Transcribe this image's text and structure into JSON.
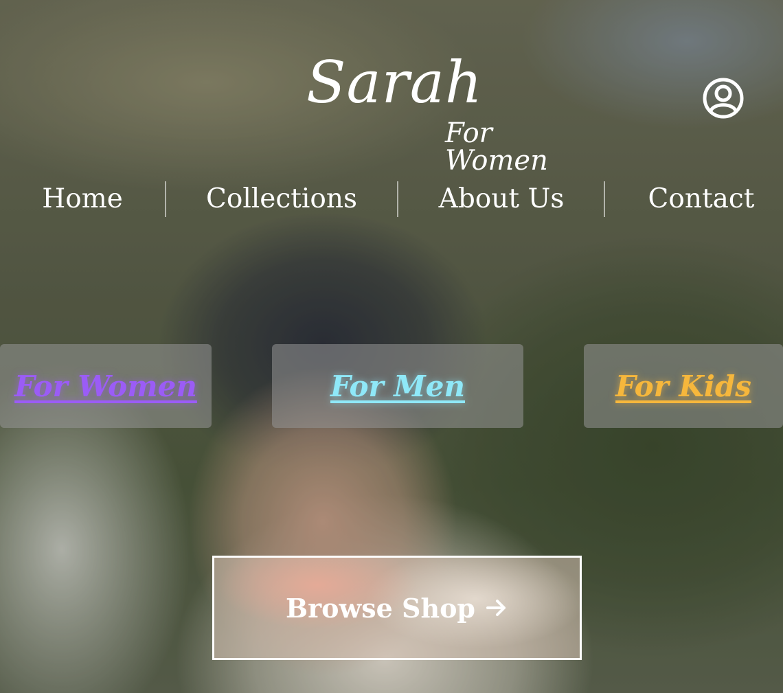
{
  "brand": {
    "name": "Sarah",
    "subtitle": "For Women"
  },
  "header": {
    "account_icon": "user-circle-icon"
  },
  "nav": {
    "items": [
      {
        "label": "Home"
      },
      {
        "label": "Collections"
      },
      {
        "label": "About Us"
      },
      {
        "label": "Contact"
      }
    ]
  },
  "categories": [
    {
      "label": "For Women",
      "color": "#9b5cf6"
    },
    {
      "label": "For Men",
      "color": "#8fe8f8"
    },
    {
      "label": "For Kids",
      "color": "#f6b73c"
    }
  ],
  "cta": {
    "label": "Browse Shop",
    "icon": "arrow-right-icon"
  }
}
